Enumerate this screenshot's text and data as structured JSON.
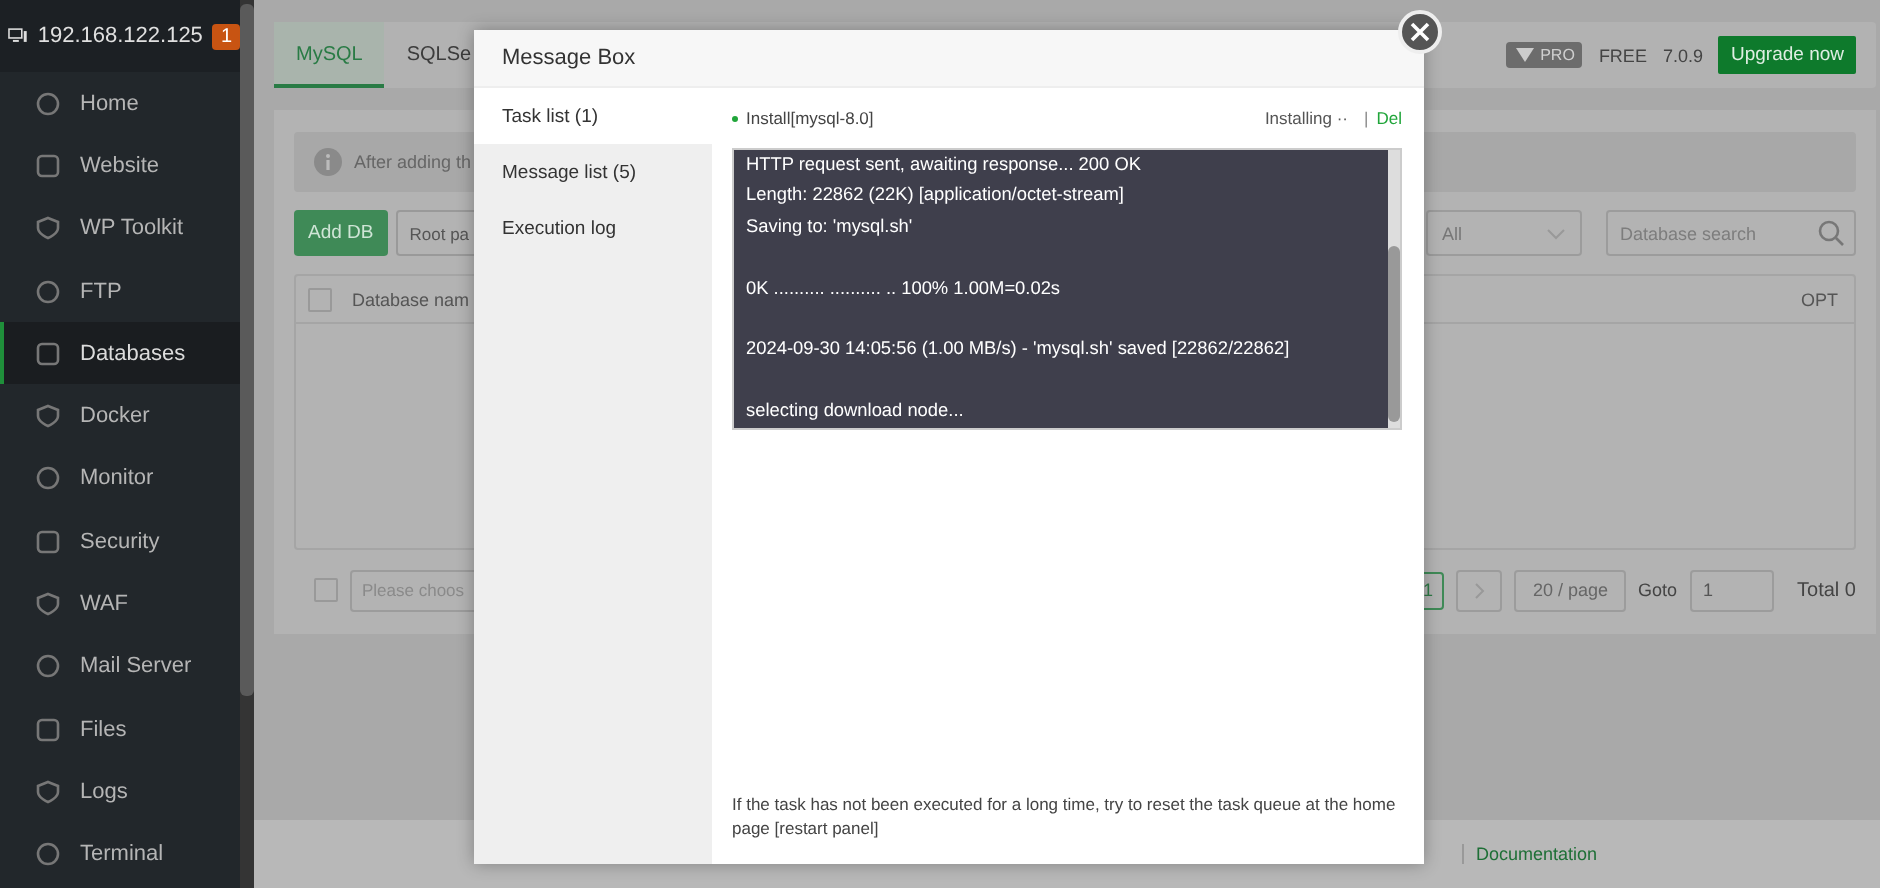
{
  "sidebar": {
    "host": "192.168.122.125",
    "badge": "1",
    "items": [
      {
        "label": "Home",
        "selected": false
      },
      {
        "label": "Website",
        "selected": false
      },
      {
        "label": "WP Toolkit",
        "selected": false
      },
      {
        "label": "FTP",
        "selected": false
      },
      {
        "label": "Databases",
        "selected": true
      },
      {
        "label": "Docker",
        "selected": false
      },
      {
        "label": "Monitor",
        "selected": false
      },
      {
        "label": "Security",
        "selected": false
      },
      {
        "label": "WAF",
        "selected": false
      },
      {
        "label": "Mail Server",
        "selected": false
      },
      {
        "label": "Files",
        "selected": false
      },
      {
        "label": "Logs",
        "selected": false
      },
      {
        "label": "Terminal",
        "selected": false
      }
    ]
  },
  "tabs": [
    {
      "label": "MySQL",
      "selected": true
    },
    {
      "label": "SQLSe",
      "selected": false
    }
  ],
  "header": {
    "pro_badge": "PRO",
    "edition": "FREE",
    "version": "7.0.9",
    "upgrade_button": "Upgrade now"
  },
  "notice": "After adding th",
  "toolbar": {
    "add_button": "Add DB",
    "root_button": "Root pa",
    "filter": "All",
    "search_placeholder": "Database search"
  },
  "table": {
    "columns": [
      "Database nam",
      "OPT"
    ],
    "select_all_checked": false
  },
  "pagination": {
    "select_all_checked": false,
    "batch_placeholder": "Please choos",
    "current_page": "1",
    "page_size": "20 / page",
    "goto_label": "Goto",
    "goto_value": "1",
    "total": "Total 0"
  },
  "footer": {
    "link": "Documentation"
  },
  "modal": {
    "title": "Message Box",
    "nav": [
      {
        "label": "Task list (1)",
        "selected": true
      },
      {
        "label": "Message list (5)",
        "selected": false
      },
      {
        "label": "Execution log",
        "selected": false
      }
    ],
    "task": {
      "name": "Install[mysql-8.0]",
      "status": "Installing ··",
      "separator": "|",
      "delete": "Del"
    },
    "log": "HTTP request sent, awaiting response... 200 OK\nLength: 22862 (22K) [application/octet-stream]\nSaving to: 'mysql.sh'\n\n0K .......... .......... .. 100% 1.00M=0.02s\n\n2024-09-30 14:05:56 (1.00 MB/s) - 'mysql.sh' saved [22862/22862]\n\nselecting download node...",
    "hint": "If the task has not been executed for a long time, try to reset the task queue at the home page [restart panel]"
  }
}
